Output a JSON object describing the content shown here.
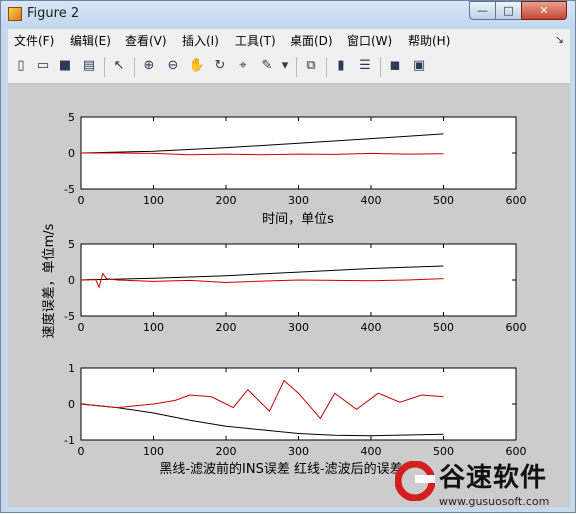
{
  "window": {
    "title": "Figure 2",
    "controls": {
      "minimize": "—",
      "maximize": "□",
      "close": "✕"
    }
  },
  "menu": {
    "items": [
      "文件(F)",
      "编辑(E)",
      "查看(V)",
      "插入(I)",
      "工具(T)",
      "桌面(D)",
      "窗口(W)",
      "帮助(H)"
    ],
    "overflow": "↘"
  },
  "toolbar": {
    "icons": [
      "new-file-icon",
      "open-folder-icon",
      "save-icon",
      "print-icon",
      "pointer-icon",
      "zoom-in-icon",
      "zoom-out-icon",
      "pan-hand-icon",
      "rotate-3d-icon",
      "data-cursor-icon",
      "brush-icon",
      "dropdown-arrow-icon",
      "link-plot-icon",
      "colorbar-icon",
      "legend-icon",
      "hide-plot-tools-icon",
      "show-plot-tools-icon"
    ]
  },
  "colors": {
    "black_line": "#000000",
    "red_line": "#cc0000",
    "figure_bg": "#cccccc"
  },
  "figure": {
    "ylabel": "速度误差，单位m/s",
    "xlabel_top": "时间，单位s",
    "caption": "黑线-滤波前的INS误差   红线-滤波后的误差"
  },
  "chart_data": [
    {
      "type": "line",
      "xlim": [
        0,
        600
      ],
      "ylim": [
        -5,
        5
      ],
      "xticks": [
        "0",
        "100",
        "200",
        "300",
        "400",
        "500",
        "600"
      ],
      "yticks": [
        "5",
        "0",
        "-5"
      ],
      "series": [
        {
          "color": "#000000",
          "x": [
            0,
            100,
            200,
            300,
            400,
            500
          ],
          "y": [
            0.0,
            0.25,
            0.75,
            1.35,
            2.0,
            2.65
          ]
        },
        {
          "color": "#cc0000",
          "x": [
            0,
            50,
            100,
            150,
            200,
            250,
            300,
            350,
            400,
            450,
            500
          ],
          "y": [
            0.0,
            0.0,
            -0.05,
            -0.25,
            -0.15,
            -0.25,
            -0.15,
            -0.2,
            -0.05,
            -0.15,
            -0.1
          ]
        }
      ]
    },
    {
      "type": "line",
      "xlim": [
        0,
        600
      ],
      "ylim": [
        -5,
        5
      ],
      "xticks": [
        "0",
        "100",
        "200",
        "300",
        "400",
        "500",
        "600"
      ],
      "yticks": [
        "5",
        "0",
        "-5"
      ],
      "series": [
        {
          "color": "#000000",
          "x": [
            0,
            100,
            200,
            300,
            400,
            500
          ],
          "y": [
            0.0,
            0.25,
            0.6,
            1.1,
            1.6,
            1.95
          ]
        },
        {
          "color": "#cc0000",
          "x": [
            0,
            20,
            25,
            30,
            35,
            50,
            100,
            150,
            200,
            250,
            300,
            350,
            400,
            450,
            500
          ],
          "y": [
            0.0,
            0.1,
            -1.0,
            0.9,
            0.2,
            0.0,
            -0.2,
            -0.05,
            -0.35,
            -0.15,
            0.0,
            -0.05,
            -0.1,
            0.0,
            0.2
          ]
        }
      ]
    },
    {
      "type": "line",
      "xlim": [
        0,
        600
      ],
      "ylim": [
        -1,
        1
      ],
      "xticks": [
        "0",
        "100",
        "200",
        "300",
        "400",
        "500",
        "600"
      ],
      "yticks": [
        "1",
        "0",
        "-1"
      ],
      "series": [
        {
          "color": "#000000",
          "x": [
            0,
            50,
            100,
            150,
            200,
            250,
            300,
            350,
            400,
            450,
            500
          ],
          "y": [
            0.0,
            -0.1,
            -0.25,
            -0.45,
            -0.62,
            -0.72,
            -0.82,
            -0.87,
            -0.88,
            -0.86,
            -0.84
          ]
        },
        {
          "color": "#cc0000",
          "x": [
            0,
            50,
            100,
            130,
            150,
            180,
            210,
            230,
            260,
            280,
            300,
            330,
            350,
            380,
            410,
            440,
            470,
            500
          ],
          "y": [
            0.0,
            -0.1,
            0.0,
            0.1,
            0.25,
            0.2,
            -0.1,
            0.4,
            -0.2,
            0.65,
            0.3,
            -0.4,
            0.3,
            -0.15,
            0.3,
            0.05,
            0.25,
            0.2
          ]
        }
      ]
    }
  ],
  "watermark": {
    "text": "谷速软件",
    "url": "www.gusuosoft.com"
  }
}
